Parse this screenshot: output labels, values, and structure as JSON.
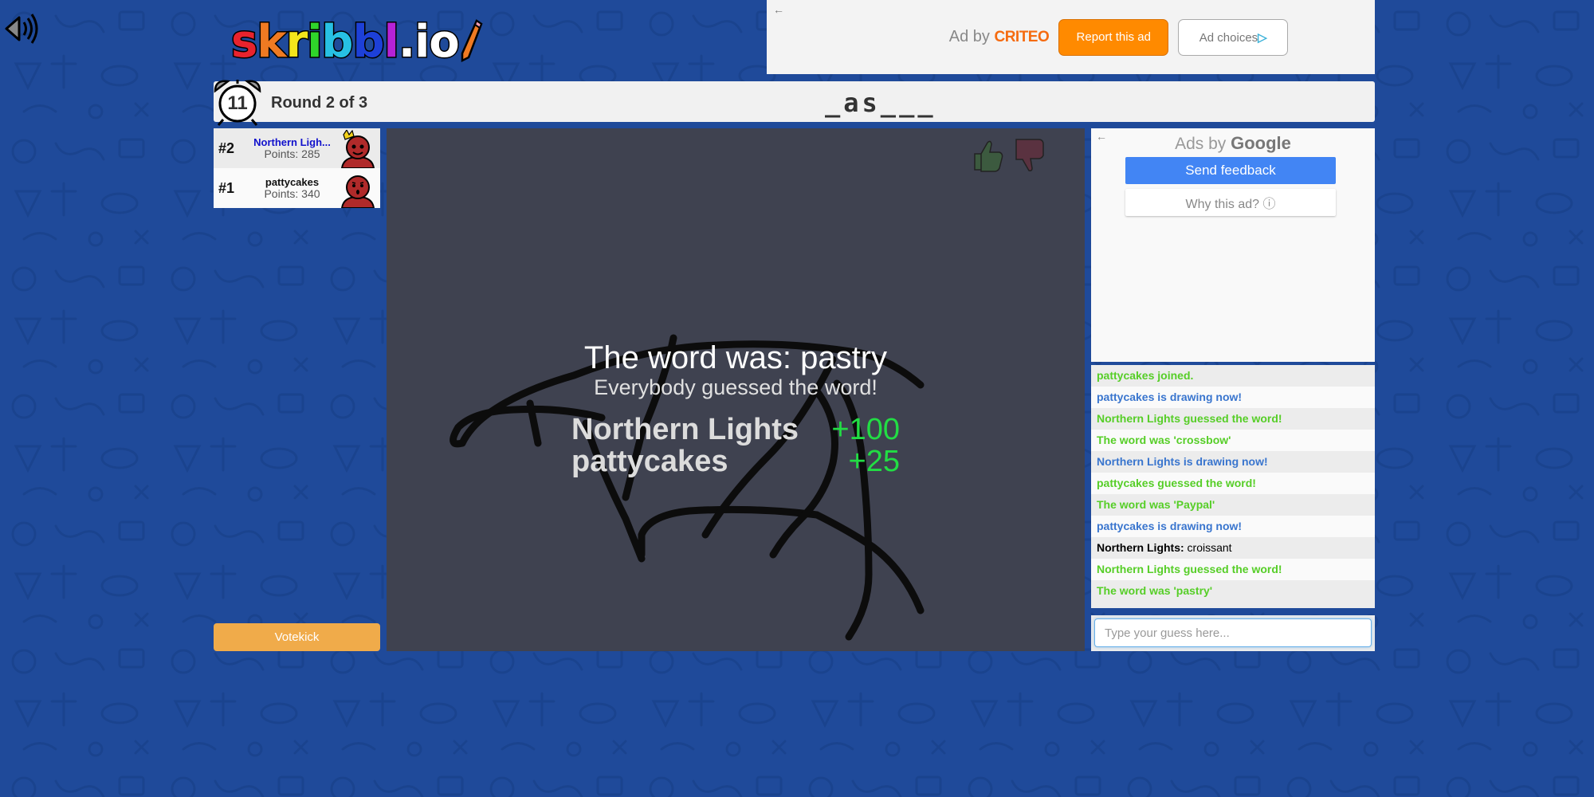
{
  "app": {
    "logo_letters": [
      {
        "ch": "s",
        "color": "#e8232d"
      },
      {
        "ch": "k",
        "color": "#ef7a22"
      },
      {
        "ch": "r",
        "color": "#f3e51b"
      },
      {
        "ch": "i",
        "color": "#2fd52a"
      },
      {
        "ch": "b",
        "color": "#27c0e3"
      },
      {
        "ch": "b",
        "color": "#1d40d8"
      },
      {
        "ch": "l",
        "color": "#b622d6"
      },
      {
        "ch": ".",
        "color": "#ffffff"
      },
      {
        "ch": "i",
        "color": "#ffffff"
      },
      {
        "ch": "o",
        "color": "#ffffff"
      }
    ],
    "sound_icon": "speaker-icon"
  },
  "ad_top": {
    "back_arrow": "←",
    "ad_by": "Ad by",
    "brand": "CRITEO",
    "report_label": "Report this ad",
    "choices_label": "Ad choices",
    "choices_icon": "▷"
  },
  "header": {
    "timer": "11",
    "round": "Round 2 of 3",
    "word_hint": "_as___"
  },
  "players": [
    {
      "rank": "#2",
      "name": "Northern Ligh...",
      "points": "Points: 285",
      "is_me": true,
      "has_crown": true,
      "face": "smile"
    },
    {
      "rank": "#1",
      "name": "pattycakes",
      "points": "Points: 340",
      "is_me": false,
      "has_crown": false,
      "face": "surprised"
    }
  ],
  "votekick_label": "Votekick",
  "canvas": {
    "overlay_title": "The word was: pastry",
    "overlay_subtitle": "Everybody guessed the word!",
    "scores": [
      {
        "name": "Northern Lights",
        "score": "+100"
      },
      {
        "name": "pattycakes",
        "score": "+25"
      }
    ],
    "rate_icons": [
      "thumbs-up-icon",
      "thumbs-down-icon"
    ]
  },
  "ad_side": {
    "back_arrow": "←",
    "ads_by": "Ads by",
    "brand": "Google",
    "feedback_label": "Send feedback",
    "why_label": "Why this ad? ⓘ"
  },
  "chat": {
    "messages": [
      {
        "type": "green",
        "text": "pattycakes joined."
      },
      {
        "type": "blue",
        "text": "pattycakes is drawing now!"
      },
      {
        "type": "green",
        "text": "Northern Lights guessed the word!"
      },
      {
        "type": "green",
        "text": "The word was 'crossbow'"
      },
      {
        "type": "blue",
        "text": "Northern Lights is drawing now!"
      },
      {
        "type": "green",
        "text": "pattycakes guessed the word!"
      },
      {
        "type": "green",
        "text": "The word was 'Paypal'"
      },
      {
        "type": "blue",
        "text": "pattycakes is drawing now!"
      },
      {
        "type": "chat",
        "author": "Northern Lights:",
        "text": "croissant"
      },
      {
        "type": "green",
        "text": "Northern Lights guessed the word!"
      },
      {
        "type": "green",
        "text": "The word was 'pastry'"
      }
    ],
    "input_value": "",
    "input_placeholder": "Type your guess here..."
  }
}
